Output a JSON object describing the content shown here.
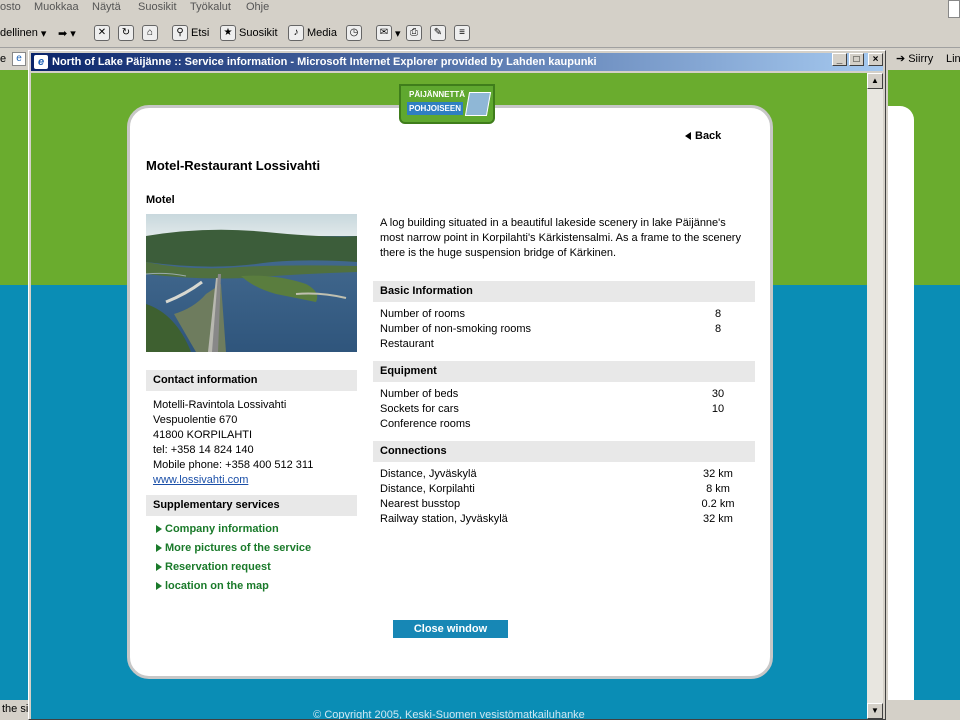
{
  "background_browser": {
    "menu": [
      "osto",
      "Muokkaa",
      "Näytä",
      "Suosikit",
      "Työkalut",
      "Ohje"
    ],
    "toolbar": {
      "previous_fragment": "dellinen",
      "search_label": "Etsi",
      "favorites_label": "Suosikit",
      "media_label": "Media",
      "go_label": "Siirry",
      "links_fragment": "Lin"
    },
    "address_fragment": "e",
    "status_fragment": "the si"
  },
  "window": {
    "title": "North of Lake Päijänne :: Service information - Microsoft Internet Explorer provided by Lahden kaupunki",
    "buttons": {
      "minimize": "_",
      "maximize": "□",
      "close": "×"
    }
  },
  "logo": {
    "line1": "PÄIJÄNNETTÄ",
    "line2": "POHJOISEEN"
  },
  "page": {
    "back_label": "Back",
    "title": "Motel-Restaurant Lossivahti",
    "subtitle": "Motel",
    "description": "A log building situated in a beautiful lakeside scenery in lake Päijänne's most narrow point in Korpilahti's Kärkistensalmi. As a frame to the scenery there is the huge suspension bridge of Kärkinen.",
    "photo_alt": "Aerial view of the Kärkinen bridge",
    "close_label": "Close window",
    "copyright": "© Copyright 2005, Keski-Suomen vesistömatkailuhanke"
  },
  "contact": {
    "heading": "Contact information",
    "lines": [
      "Motelli-Ravintola Lossivahti",
      "Vespuolentie 670",
      "41800 KORPILAHTI",
      "tel: +358 14 824 140",
      "Mobile phone: +358 400 512 311"
    ],
    "website": "www.lossivahti.com"
  },
  "supplementary": {
    "heading": "Supplementary services",
    "items": [
      "Company information",
      "More pictures of the service",
      "Reservation request",
      "location on the map"
    ]
  },
  "basic": {
    "heading": "Basic Information",
    "rows": [
      {
        "label": "Number of rooms",
        "value": "8"
      },
      {
        "label": "Number of non-smoking rooms",
        "value": "8"
      },
      {
        "label": "Restaurant",
        "value": ""
      }
    ]
  },
  "equipment": {
    "heading": "Equipment",
    "rows": [
      {
        "label": "Number of beds",
        "value": "30"
      },
      {
        "label": "Sockets for cars",
        "value": "10"
      },
      {
        "label": "Conference rooms",
        "value": ""
      }
    ]
  },
  "connections": {
    "heading": "Connections",
    "rows": [
      {
        "label": "Distance, Jyväskylä",
        "value": "32 km"
      },
      {
        "label": "Distance, Korpilahti",
        "value": "8 km"
      },
      {
        "label": "Nearest busstop",
        "value": "0.2 km"
      },
      {
        "label": "Railway station, Jyväskylä",
        "value": "32 km"
      }
    ]
  },
  "colors": {
    "green": "#6aac2e",
    "blue": "#0a8db5",
    "link_green": "#1a7a2a",
    "button_blue": "#1787b5"
  }
}
